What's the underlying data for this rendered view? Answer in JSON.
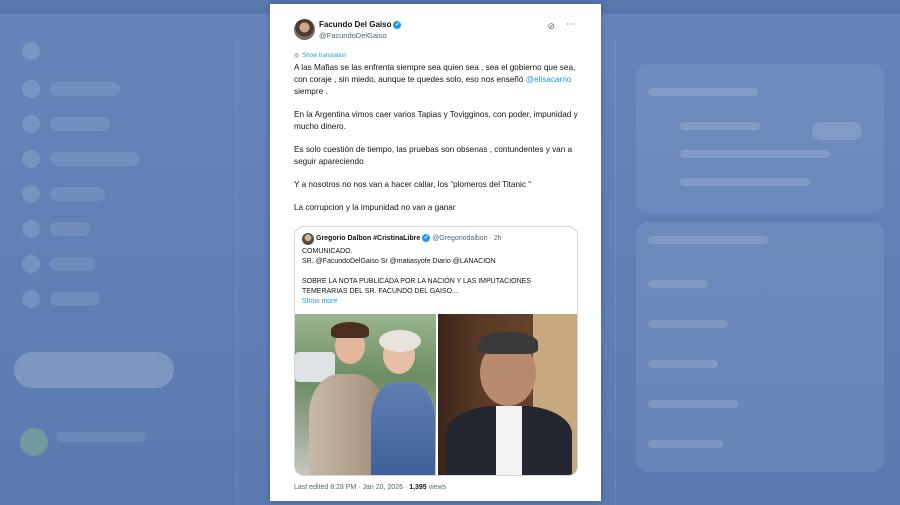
{
  "tweet": {
    "author_name": "Facundo Del Gaiso",
    "author_handle": "@FacundoDelGaiso",
    "translate_label": "Show translation",
    "paragraphs": {
      "p1_before": "A las Mafias se las enfrenta siempre sea quien sea , sea el gobierno que sea, con coraje , sin miedo, aunque te quedes solo, eso nos enseñó ",
      "p1_mention": "@elisacarrio",
      "p1_after": " siempre .",
      "p2": "En la Argentina vimos caer varios Tapias y Toviggino​s, con poder, impunidad y mucho dinero.",
      "p3": "Es solo cuestión de tiempo, las pruebas son obsenas , contundentes y van a seguir apareciendo",
      "p4": "Y a nosotros no nos van a hacer callar, los “plomeros del Titanic “",
      "p5": "La corrupcion y la impunidad no van a ganar"
    },
    "footer": {
      "edited": "Last edited 8:28 PM · Jan 20, 2026 · ",
      "views_count": "1,395",
      "views_label": " views"
    }
  },
  "quote": {
    "author_name": "Gregorio Dalbon #CristinaLibre",
    "author_handle": "@Gregoriodalbon · 2h",
    "line1": "COMUNICADO.",
    "line2": "SR. @FacundoDelGaiso Sr @matiasyofe Diario @LANACION",
    "line3": "SOBRE LA NOTA PUBLICADA POR LA NACIÓN Y LAS IMPUTACIONES",
    "line4": "TEMERARIAS DEL SR. FACUNDO DEL GAISO...",
    "show_more": "Show more"
  },
  "icons": {
    "verified": "verified-badge-icon",
    "grok": "grok-icon",
    "more": "more-options-icon",
    "translate": "translate-icon"
  },
  "colors": {
    "accent": "#1d9bf0",
    "background": "#5f7fb5",
    "text": "#0f1419",
    "muted": "#536471"
  }
}
